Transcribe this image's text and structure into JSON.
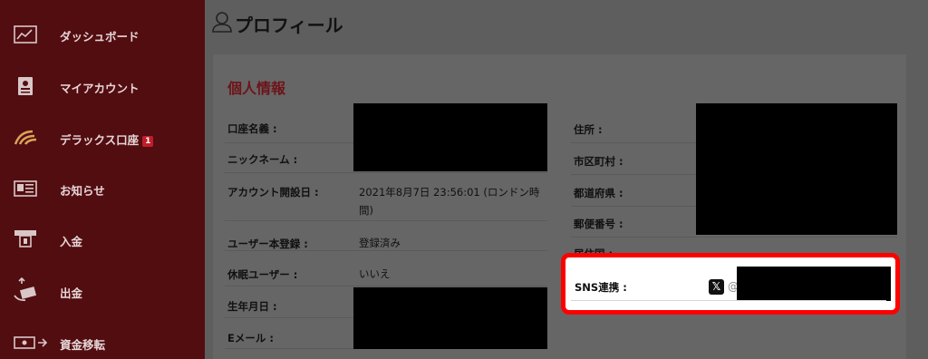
{
  "sidebar": {
    "items": [
      {
        "label": "ダッシュボード",
        "icon": "dashboard-chart-icon"
      },
      {
        "label": "マイアカウント",
        "icon": "account-card-icon"
      },
      {
        "label": "デラックス口座",
        "icon": "deluxe-logo-icon",
        "badge": "1"
      },
      {
        "label": "お知らせ",
        "icon": "newspaper-icon"
      },
      {
        "label": "入金",
        "icon": "deposit-icon"
      },
      {
        "label": "出金",
        "icon": "withdraw-icon"
      },
      {
        "label": "資金移転",
        "icon": "transfer-icon"
      }
    ]
  },
  "header": {
    "title": "プロフィール",
    "icon": "user-icon"
  },
  "personal_info": {
    "title": "個人情報",
    "left": [
      {
        "label": "口座名義 :",
        "value": ""
      },
      {
        "label": "ニックネーム :",
        "value": ""
      },
      {
        "label": "アカウント開設日 :",
        "value": "2021年8月7日 23:56:01 (ロンドン時間)"
      },
      {
        "label": "ユーザー本登録 :",
        "value": "登録済み"
      },
      {
        "label": "休眠ユーザー :",
        "value": "いいえ"
      },
      {
        "label": "生年月日 :",
        "value": ""
      },
      {
        "label": "Eメール :",
        "value": ""
      }
    ],
    "right": [
      {
        "label": "住所 :",
        "value": ""
      },
      {
        "label": "市区町村 :",
        "value": ""
      },
      {
        "label": "都道府県 :",
        "value": ""
      },
      {
        "label": "郵便番号 :",
        "value": ""
      },
      {
        "label": "居住国 :",
        "value": ""
      }
    ],
    "sns": {
      "label": "SNS連携 :",
      "icon": "x-logo-icon",
      "prefix": "@",
      "value": ""
    }
  },
  "colors": {
    "sidebar": "#520d11",
    "accent": "#bf1e29",
    "highlight": "#ff0000"
  }
}
